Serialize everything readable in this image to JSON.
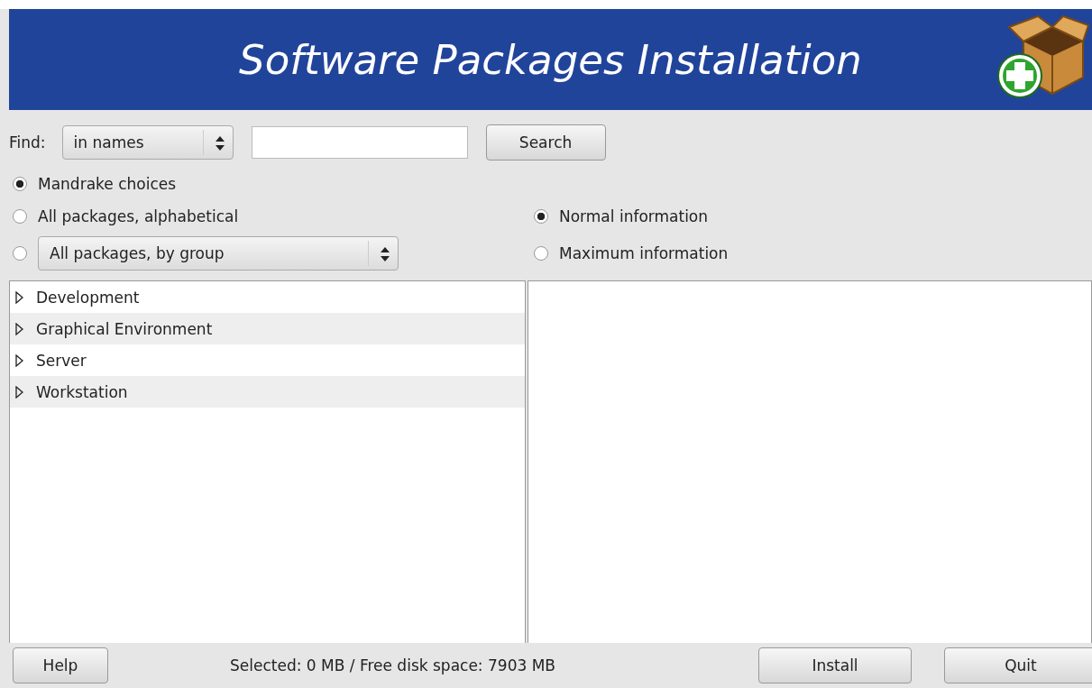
{
  "header": {
    "title": "Software Packages Installation"
  },
  "find": {
    "label": "Find:",
    "scope": "in names",
    "search_button": "Search"
  },
  "view_modes": [
    {
      "kind": "radio",
      "label": "Mandrake choices",
      "selected": true
    },
    {
      "kind": "radio",
      "label": "All packages, alphabetical",
      "selected": false
    },
    {
      "kind": "dropdown",
      "label": "All packages, by group",
      "selected": false
    }
  ],
  "info_modes": [
    {
      "label": "Normal information",
      "selected": true
    },
    {
      "label": "Maximum information",
      "selected": false
    }
  ],
  "tree": [
    {
      "label": "Development",
      "expanded": false
    },
    {
      "label": "Graphical Environment",
      "expanded": false
    },
    {
      "label": "Server",
      "expanded": false
    },
    {
      "label": "Workstation",
      "expanded": false
    }
  ],
  "status_bar": {
    "help": "Help",
    "status": "Selected: 0 MB / Free disk space: 7903 MB",
    "install": "Install",
    "quit": "Quit"
  }
}
